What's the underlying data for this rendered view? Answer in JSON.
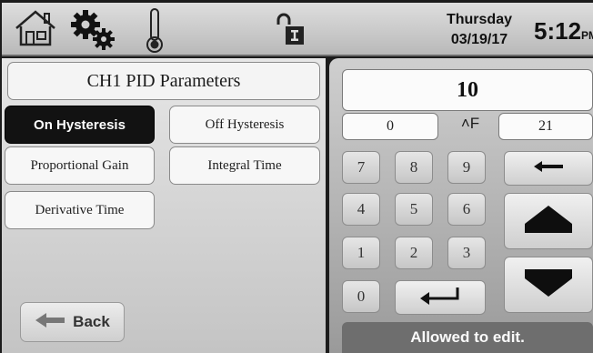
{
  "header": {
    "day": "Thursday",
    "date": "03/19/17",
    "time": "5:12",
    "time_suffix": "PM",
    "icons": [
      "home-icon",
      "gears-icon",
      "thermometer-icon",
      "unlock-icon"
    ]
  },
  "left": {
    "title": "CH1 PID Parameters",
    "buttons": {
      "on_hysteresis": "On Hysteresis",
      "off_hysteresis": "Off Hysteresis",
      "proportional_gain": "Proportional Gain",
      "integral_time": "Integral Time",
      "derivative_time": "Derivative Time"
    },
    "active": "on_hysteresis",
    "back_label": "Back"
  },
  "keypad": {
    "value": "10",
    "min": "0",
    "unit": "˄F",
    "max": "21",
    "keys": [
      "7",
      "8",
      "9",
      "4",
      "5",
      "6",
      "1",
      "2",
      "3",
      "0"
    ],
    "status": "Allowed to edit."
  }
}
